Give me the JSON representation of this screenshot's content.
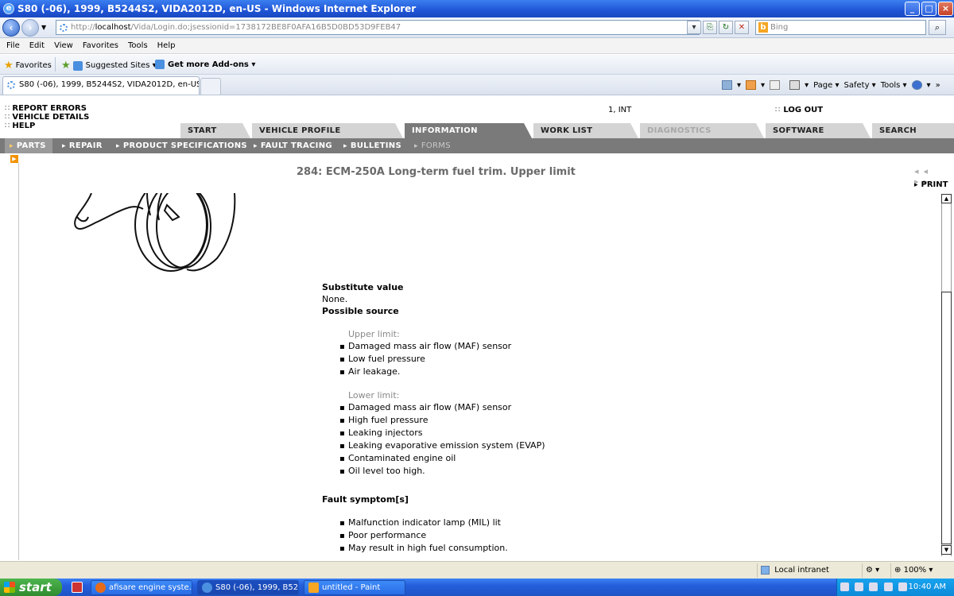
{
  "window": {
    "title": "S80 (-06), 1999, B5244S2, VIDA2012D, en-US - Windows Internet Explorer"
  },
  "browser": {
    "address_host": "localhost",
    "address_prefix": "http://",
    "address_rest": "/Vida/Login.do;jsessionid=1738172BE8F0AFA16B5D0BD53D9FEB47",
    "search_placeholder": "Bing",
    "menu": [
      "File",
      "Edit",
      "View",
      "Favorites",
      "Tools",
      "Help"
    ],
    "favorites_label": "Favorites",
    "suggested_sites": "Suggested Sites ▾",
    "get_addons": "Get more Add-ons ▾",
    "tab_title": "S80 (-06), 1999, B5244S2, VIDA2012D, en-US",
    "tools": [
      "Page ▾",
      "Safety ▾",
      "Tools ▾"
    ]
  },
  "app": {
    "top_links": [
      "REPORT ERRORS",
      "VEHICLE DETAILS",
      "HELP"
    ],
    "user_info": "1, INT",
    "logout": "LOG OUT",
    "tabs": [
      "START",
      "VEHICLE PROFILE",
      "INFORMATION",
      "WORK LIST",
      "DIAGNOSTICS",
      "SOFTWARE",
      "SEARCH"
    ],
    "active_tab": "INFORMATION",
    "disabled_tab": "DIAGNOSTICS",
    "subnav": [
      "PARTS",
      "REPAIR",
      "PRODUCT SPECIFICATIONS",
      "FAULT TRACING",
      "BULLETINS",
      "FORMS"
    ],
    "doc_nav": "◂◂ ▸▸",
    "print": "PRINT"
  },
  "document": {
    "title": "284: ECM-250A Long-term fuel trim. Upper limit",
    "substitute_heading": "Substitute value",
    "substitute_value": "None.",
    "possible_source_heading": "Possible source",
    "upper_label": "Upper limit:",
    "upper_items": [
      "Damaged mass air flow (MAF) sensor",
      "Low fuel pressure",
      "Air leakage."
    ],
    "lower_label": "Lower limit:",
    "lower_items": [
      "Damaged mass air flow (MAF) sensor",
      "High fuel pressure",
      "Leaking injectors",
      "Leaking evaporative emission system (EVAP)",
      "Contaminated engine oil",
      "Oil level too high."
    ],
    "fault_heading": "Fault symptom[s]",
    "fault_items": [
      "Malfunction indicator lamp (MIL) lit",
      "Poor performance",
      "May result in high fuel consumption."
    ]
  },
  "status": {
    "zone": "Local intranet",
    "zoom": "100%"
  },
  "taskbar": {
    "start": "start",
    "items": [
      "afisare engine syste...",
      "S80 (-06), 1999, B52...",
      "untitled - Paint"
    ],
    "clock": "10:40 AM"
  }
}
